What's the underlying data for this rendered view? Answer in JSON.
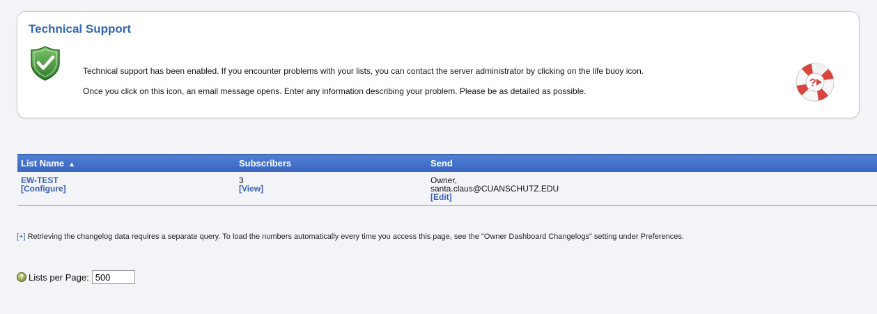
{
  "support": {
    "title": "Technical Support",
    "line1": "Technical support has been enabled. If you encounter problems with your lists, you can contact the server administrator by clicking on the life buoy icon.",
    "line2": "Once you click on this icon, an email message opens. Enter any information describing your problem. Please be as detailed as possible.",
    "status_icon": "shield-check-icon",
    "help_icon": "life-buoy-icon"
  },
  "table": {
    "headers": {
      "list_name": "List Name",
      "subscribers": "Subscribers",
      "send": "Send"
    },
    "sort_indicator": "▲",
    "rows": [
      {
        "name": "EW-TEST",
        "configure": "[Configure]",
        "subscribers": "3",
        "view": "[View]",
        "send_line1": "Owner,",
        "send_line2": "santa.claus@CUANSCHUTZ.EDU",
        "edit": "[Edit]"
      }
    ]
  },
  "changelog": {
    "toggle": "[+]",
    "text": "Retrieving the changelog data requires a separate query. To load the numbers automatically every time you access this page, see the \"Owner Dashboard Changelogs\" setting under Preferences."
  },
  "lists_per_page": {
    "label": "Lists per Page:",
    "value": "500",
    "help_glyph": "?"
  },
  "colors": {
    "title_blue": "#3366b6",
    "header_blue": "#3a66c0",
    "link_blue": "#3a5fb0",
    "shield_green": "#4f9a3c",
    "buoy_red": "#d9443f"
  }
}
